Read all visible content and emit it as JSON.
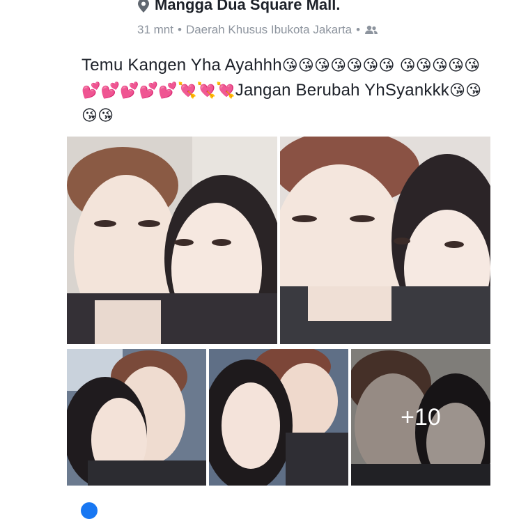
{
  "header": {
    "location": "Mangga Dua Square Mall.",
    "time": "31 mnt",
    "separator": "•",
    "region": "Daerah Khusus Ibukota Jakarta",
    "audience_icon": "friends-icon",
    "location_icon": "map-pin-icon"
  },
  "post": {
    "text_part1": "Temu Kangen Yha Ayahhh",
    "emoji_kiss_row1": "😘😘😘😘😘😘😘",
    "emoji_kiss_row2": "😘😘😘😘😘",
    "emoji_hearts": "💕💕💕💕💕",
    "emoji_cupid": "💘💘💘",
    "text_part2": "Jangan Berubah YhSyankkk",
    "emoji_kiss_end": "😘😘😘😘"
  },
  "photos": {
    "more_count": "+10"
  },
  "footer": {
    "left_text": "",
    "right_text": ""
  },
  "colors": {
    "text": "#1d2129",
    "meta": "#8d949e",
    "accent": "#1877f2"
  }
}
